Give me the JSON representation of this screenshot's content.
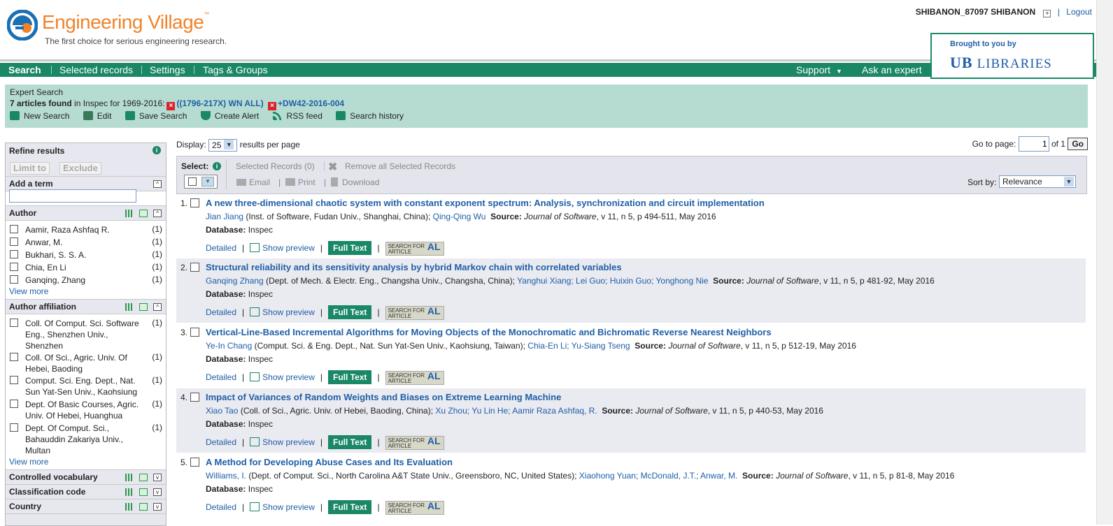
{
  "header": {
    "logo_text": "Engineering Village",
    "logo_tm": "™",
    "tagline": "The first choice for serious engineering research.",
    "user_name": "SHIBANON_87097 SHIBANON",
    "logout": "Logout",
    "brought_to_you": "Brought to you by",
    "libraries_ub": "UB",
    "libraries": "LIBRARIES"
  },
  "nav": {
    "items": [
      "Search",
      "Selected records",
      "Settings",
      "Tags & Groups"
    ],
    "support": "Support",
    "ask": "Ask an expert"
  },
  "expert": {
    "title": "Expert Search",
    "count": "7 articles found",
    "db_text": "in Inspec for 1969-2016:",
    "term1": "((1796-217X) WN ALL)",
    "term2": "+DW42-2016-004",
    "tools": [
      "New Search",
      "Edit",
      "Save Search",
      "Create Alert",
      "RSS feed",
      "Search history"
    ]
  },
  "sidebar": {
    "refine": "Refine results",
    "limit": "Limit to",
    "exclude": "Exclude",
    "add_term": "Add a term",
    "author_head": "Author",
    "authors": [
      {
        "name": "Aamir, Raza Ashfaq R.",
        "count": "(1)"
      },
      {
        "name": "Anwar, M.",
        "count": "(1)"
      },
      {
        "name": "Bukhari, S. S. A.",
        "count": "(1)"
      },
      {
        "name": "Chia, En Li",
        "count": "(1)"
      },
      {
        "name": "Ganqing, Zhang",
        "count": "(1)"
      }
    ],
    "view_more": "View more",
    "affil_head": "Author affiliation",
    "affils": [
      {
        "name": "Coll. Of Comput. Sci. Software Eng., Shenzhen Univ., Shenzhen",
        "count": "(1)"
      },
      {
        "name": "Coll. Of Sci., Agric. Univ. Of Hebei, Baoding",
        "count": "(1)"
      },
      {
        "name": "Comput. Sci. Eng. Dept., Nat. Sun Yat-Sen Univ., Kaohsiung",
        "count": "(1)"
      },
      {
        "name": "Dept. Of Basic Courses, Agric. Univ. Of Hebei, Huanghua",
        "count": "(1)"
      },
      {
        "name": "Dept. Of Comput. Sci., Bahauddin Zakariya Univ., Multan",
        "count": "(1)"
      }
    ],
    "controlled": "Controlled vocabulary",
    "classification": "Classification code",
    "country": "Country"
  },
  "results": {
    "display_label": "Display:",
    "display_value": "25",
    "per_page": "results per page",
    "goto_label": "Go to page:",
    "goto_value": "1",
    "of_label": "of 1",
    "go": "Go",
    "select_label": "Select:",
    "selected_records": "Selected Records (0)",
    "remove_all": "Remove all Selected Records",
    "email": "Email",
    "print": "Print",
    "download": "Download",
    "sort_label": "Sort by:",
    "sort_value": "Relevance",
    "detailed": "Detailed",
    "show_preview": "Show preview",
    "full_text": "Full Text",
    "sfa_line1": "SEARCH FOR",
    "sfa_line2": "ARTICLE",
    "sfa_al": "AL",
    "database_label": "Database:",
    "database_value": "Inspec",
    "source_label": "Source:",
    "items": [
      {
        "num": "1.",
        "title": "A new three-dimensional chaotic system with constant exponent spectrum: Analysis, synchronization and circuit implementation",
        "author_main": "Jian Jiang",
        "affil": "(Inst. of Software, Fudan Univ., Shanghai, China);",
        "coauthors": "Qing-Qing Wu",
        "journal": "Journal of Software",
        "details": ", v 11, n 5, p 494-511, May 2016"
      },
      {
        "num": "2.",
        "title": "Structural reliability and its sensitivity analysis by hybrid Markov chain with correlated variables",
        "author_main": "Ganqing Zhang",
        "affil": "(Dept. of Mech. & Electr. Eng., Changsha Univ., Changsha, China);",
        "coauthors": "Yanghui Xiang; Lei Guo; Huixin Guo; Yonghong Nie",
        "journal": "Journal of Software",
        "details": ", v 11, n 5, p 481-92, May 2016"
      },
      {
        "num": "3.",
        "title": "Vertical-Line-Based Incremental Algorithms for Moving Objects of the Monochromatic and Bichromatic Reverse Nearest Neighbors",
        "author_main": "Ye-In Chang",
        "affil": "(Comput. Sci. & Eng. Dept., Nat. Sun Yat-Sen Univ., Kaohsiung, Taiwan);",
        "coauthors": "Chia-En Li; Yu-Siang Tseng",
        "journal": "Journal of Software",
        "details": ", v 11, n 5, p 512-19, May 2016"
      },
      {
        "num": "4.",
        "title": "Impact of Variances of Random Weights and Biases on Extreme Learning Machine",
        "author_main": "Xiao Tao",
        "affil": "(Coll. of Sci., Agric. Univ. of Hebei, Baoding, China);",
        "coauthors": "Xu Zhou; Yu Lin He; Aamir Raza Ashfaq, R.",
        "journal": "Journal of Software",
        "details": ", v 11, n 5, p 440-53, May 2016"
      },
      {
        "num": "5.",
        "title": "A Method for Developing Abuse Cases and Its Evaluation",
        "author_main": "Williams, I.",
        "affil": "(Dept. of Comput. Sci., North Carolina A&T State Univ., Greensboro, NC, United States);",
        "coauthors": "Xiaohong Yuan; McDonald, J.T.; Anwar, M.",
        "journal": "Journal of Software",
        "details": ", v 11, n 5, p 81-8, May 2016"
      }
    ]
  },
  "colors": {
    "green": "#1a8766",
    "link": "#1f5fa6",
    "orange": "#f0832a",
    "panel": "#b6dcd2"
  }
}
